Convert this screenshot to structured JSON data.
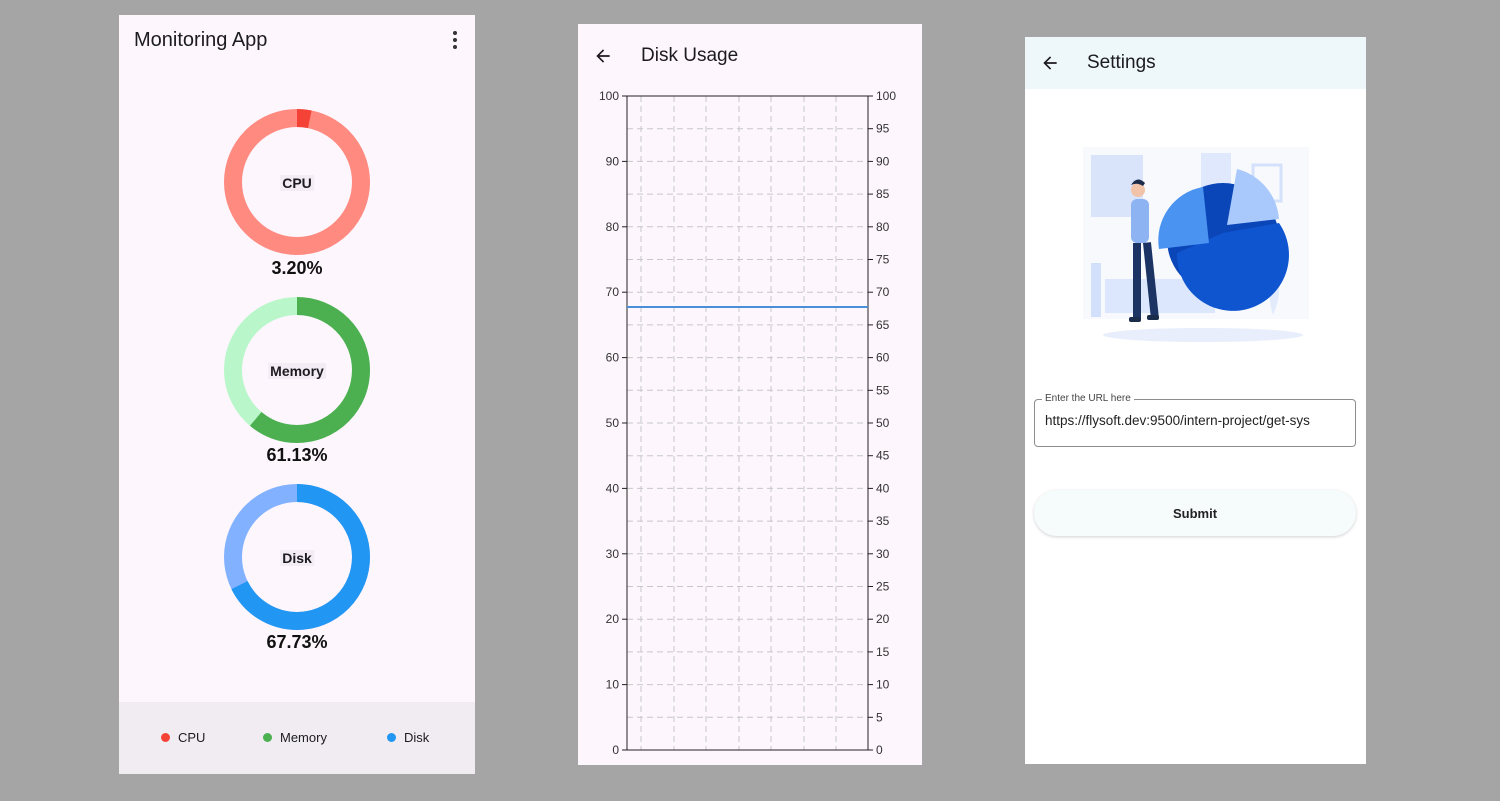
{
  "monitor": {
    "title": "Monitoring App",
    "gauges": [
      {
        "label": "CPU",
        "percent": 3.2,
        "percent_text": "3.20%",
        "color": "#f44336",
        "track": "#ff8a80"
      },
      {
        "label": "Memory",
        "percent": 61.13,
        "percent_text": "61.13%",
        "color": "#4caf50",
        "track": "#b9f6ca"
      },
      {
        "label": "Disk",
        "percent": 67.73,
        "percent_text": "67.73%",
        "color": "#2196f3",
        "track": "#82b1ff"
      }
    ],
    "legend": [
      {
        "label": "CPU",
        "color": "#f44336"
      },
      {
        "label": "Memory",
        "color": "#4caf50"
      },
      {
        "label": "Disk",
        "color": "#2196f3"
      }
    ]
  },
  "disk_usage": {
    "title": "Disk Usage"
  },
  "chart_data": {
    "type": "line",
    "title": "Disk Usage",
    "series": [
      {
        "values": [
          67.73,
          67.73
        ]
      }
    ],
    "line_color": "#4a90d9",
    "ylim": [
      0,
      100
    ],
    "left_ticks": [
      0,
      10,
      20,
      30,
      40,
      50,
      60,
      70,
      80,
      90,
      100
    ],
    "right_ticks": [
      0,
      5,
      10,
      15,
      20,
      25,
      30,
      35,
      40,
      45,
      50,
      55,
      60,
      65,
      70,
      75,
      80,
      85,
      90,
      95,
      100
    ],
    "grid": true
  },
  "settings": {
    "title": "Settings",
    "url_label": "Enter the URL here",
    "url_value": "https://flysoft.dev:9500/intern-project/get-sys",
    "submit_label": "Submit"
  },
  "icons": {
    "back": "arrow-back-icon",
    "menu": "more-vert-icon"
  }
}
